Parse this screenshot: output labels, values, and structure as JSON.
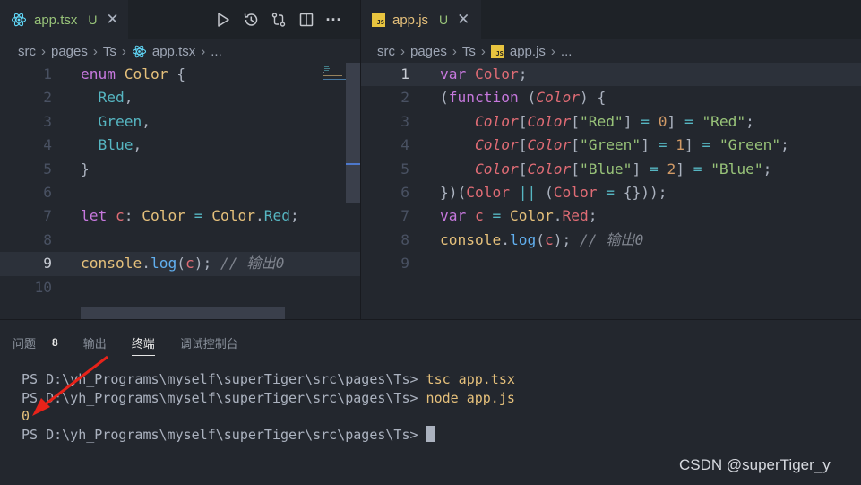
{
  "left_editor": {
    "tab": {
      "label": "app.tsx",
      "status": "U",
      "close_glyph": "✕",
      "icon": "react-icon"
    },
    "actions": [
      {
        "name": "run-button",
        "icon": "play-icon"
      },
      {
        "name": "timeline-button",
        "icon": "history-icon"
      },
      {
        "name": "compare-changes-button",
        "icon": "git-compare-icon"
      },
      {
        "name": "split-editor-button",
        "icon": "split-editor-icon"
      },
      {
        "name": "more-actions-button",
        "glyph": "···"
      }
    ],
    "breadcrumb": {
      "items": [
        "src",
        "pages",
        "Ts",
        "app.tsx",
        "..."
      ],
      "separator": "›"
    },
    "active_line": 9,
    "lines": [
      [
        [
          "kw",
          "enum "
        ],
        [
          "ty",
          "Color "
        ],
        [
          "punc",
          "{"
        ]
      ],
      [
        [
          "punc",
          "  "
        ],
        [
          "en",
          "Red"
        ],
        [
          "punc",
          ","
        ]
      ],
      [
        [
          "punc",
          "  "
        ],
        [
          "en",
          "Green"
        ],
        [
          "punc",
          ","
        ]
      ],
      [
        [
          "punc",
          "  "
        ],
        [
          "en",
          "Blue"
        ],
        [
          "punc",
          ","
        ]
      ],
      [
        [
          "punc",
          "}"
        ]
      ],
      [],
      [
        [
          "kw",
          "let "
        ],
        [
          "var",
          "c"
        ],
        [
          "punc",
          ": "
        ],
        [
          "ty",
          "Color "
        ],
        [
          "op",
          "= "
        ],
        [
          "ty",
          "Color"
        ],
        [
          "punc",
          "."
        ],
        [
          "en",
          "Red"
        ],
        [
          "punc",
          ";"
        ]
      ],
      [],
      [
        [
          "ty",
          "console"
        ],
        [
          "punc",
          "."
        ],
        [
          "fn",
          "log"
        ],
        [
          "punc",
          "("
        ],
        [
          "var",
          "c"
        ],
        [
          "punc",
          ");"
        ],
        [
          "cmt",
          " // 输出0"
        ]
      ],
      []
    ]
  },
  "right_editor": {
    "tab": {
      "label": "app.js",
      "status": "U",
      "close_glyph": "✕",
      "icon": "js-icon",
      "icon_text": "JS"
    },
    "breadcrumb": {
      "items": [
        "src",
        "pages",
        "Ts",
        "app.js",
        "..."
      ],
      "separator": "›"
    },
    "active_line": 1,
    "lines": [
      [
        [
          "kw",
          "var "
        ],
        [
          "var",
          "Color"
        ],
        [
          "punc",
          ";"
        ]
      ],
      [
        [
          "punc",
          "("
        ],
        [
          "kw",
          "function "
        ],
        [
          "punc",
          "("
        ],
        [
          "param",
          "Color"
        ],
        [
          "punc",
          ") {"
        ]
      ],
      [
        [
          "punc",
          "    "
        ],
        [
          "param",
          "Color"
        ],
        [
          "punc",
          "["
        ],
        [
          "param",
          "Color"
        ],
        [
          "punc",
          "["
        ],
        [
          "str",
          "\"Red\""
        ],
        [
          "punc",
          "] "
        ],
        [
          "op",
          "= "
        ],
        [
          "num",
          "0"
        ],
        [
          "punc",
          "] "
        ],
        [
          "op",
          "= "
        ],
        [
          "str",
          "\"Red\""
        ],
        [
          "punc",
          ";"
        ]
      ],
      [
        [
          "punc",
          "    "
        ],
        [
          "param",
          "Color"
        ],
        [
          "punc",
          "["
        ],
        [
          "param",
          "Color"
        ],
        [
          "punc",
          "["
        ],
        [
          "str",
          "\"Green\""
        ],
        [
          "punc",
          "] "
        ],
        [
          "op",
          "= "
        ],
        [
          "num",
          "1"
        ],
        [
          "punc",
          "] "
        ],
        [
          "op",
          "= "
        ],
        [
          "str",
          "\"Green\""
        ],
        [
          "punc",
          ";"
        ]
      ],
      [
        [
          "punc",
          "    "
        ],
        [
          "param",
          "Color"
        ],
        [
          "punc",
          "["
        ],
        [
          "param",
          "Color"
        ],
        [
          "punc",
          "["
        ],
        [
          "str",
          "\"Blue\""
        ],
        [
          "punc",
          "] "
        ],
        [
          "op",
          "= "
        ],
        [
          "num",
          "2"
        ],
        [
          "punc",
          "] "
        ],
        [
          "op",
          "= "
        ],
        [
          "str",
          "\"Blue\""
        ],
        [
          "punc",
          ";"
        ]
      ],
      [
        [
          "punc",
          "})("
        ],
        [
          "var",
          "Color "
        ],
        [
          "op",
          "|| "
        ],
        [
          "punc",
          "("
        ],
        [
          "var",
          "Color "
        ],
        [
          "op",
          "= "
        ],
        [
          "punc",
          "{}));"
        ]
      ],
      [
        [
          "kw",
          "var "
        ],
        [
          "var",
          "c "
        ],
        [
          "op",
          "= "
        ],
        [
          "ty",
          "Color"
        ],
        [
          "punc",
          "."
        ],
        [
          "var",
          "Red"
        ],
        [
          "punc",
          ";"
        ]
      ],
      [
        [
          "ty",
          "console"
        ],
        [
          "punc",
          "."
        ],
        [
          "fn",
          "log"
        ],
        [
          "punc",
          "("
        ],
        [
          "var",
          "c"
        ],
        [
          "punc",
          ");"
        ],
        [
          "cmt",
          " // 输出0"
        ]
      ],
      []
    ]
  },
  "panel": {
    "tabs": [
      {
        "label": "问题",
        "count": "8",
        "active": false
      },
      {
        "label": "输出",
        "active": false
      },
      {
        "label": "终端",
        "active": true
      },
      {
        "label": "调试控制台",
        "active": false
      }
    ],
    "terminal": {
      "lines": [
        {
          "prompt": "PS D:\\yh_Programs\\myself\\superTiger\\src\\pages\\Ts> ",
          "command": "tsc app.tsx"
        },
        {
          "prompt": "PS D:\\yh_Programs\\myself\\superTiger\\src\\pages\\Ts> ",
          "command": "node app.js"
        },
        {
          "output": "0"
        },
        {
          "prompt": "PS D:\\yh_Programs\\myself\\superTiger\\src\\pages\\Ts> ",
          "cursor": true
        }
      ]
    }
  },
  "watermark": "CSDN @superTiger_y",
  "colors": {
    "keyword": "#c678dd",
    "type": "#e5c07b",
    "enum_member": "#56b6c2",
    "variable": "#e06c75",
    "function": "#61afef",
    "string": "#98c379",
    "number": "#d19a66",
    "comment": "#7f848e",
    "annotation_arrow": "#e8231a",
    "background": "#23272e"
  }
}
